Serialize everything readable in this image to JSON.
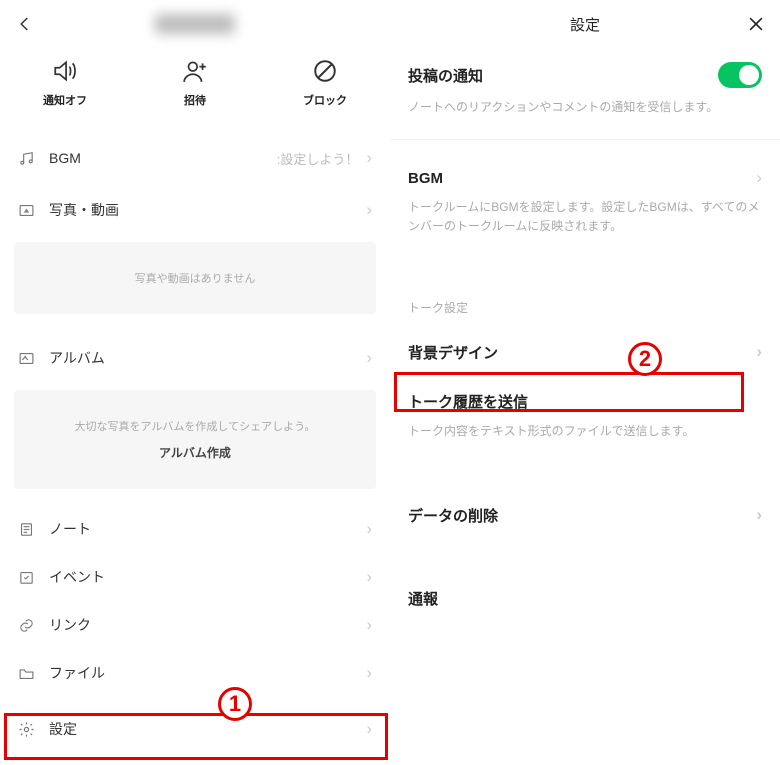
{
  "left": {
    "actions": {
      "mute": "通知オフ",
      "invite": "招待",
      "block": "ブロック"
    },
    "bgm": {
      "label": "BGM",
      "hint": ":設定しよう！"
    },
    "photos": {
      "label": "写真・動画",
      "empty": "写真や動画はありません"
    },
    "album": {
      "label": "アルバム",
      "empty1": "大切な写真をアルバムを作成してシェアしよう。",
      "create": "アルバム作成"
    },
    "rows": {
      "note": "ノート",
      "event": "イベント",
      "link": "リンク",
      "file": "ファイル",
      "settings": "設定"
    }
  },
  "right": {
    "title": "設定",
    "postNotif": {
      "title": "投稿の通知",
      "desc": "ノートへのリアクションやコメントの通知を受信します。"
    },
    "bgm": {
      "title": "BGM",
      "desc": "トークルームにBGMを設定します。設定したBGMは、すべてのメンバーのトークルームに反映されます。"
    },
    "groupLabel": "トーク設定",
    "bgDesign": "背景デザイン",
    "sendHistory": {
      "title": "トーク履歴を送信",
      "desc": "トーク内容をテキスト形式のファイルで送信します。"
    },
    "deleteData": "データの削除",
    "report": "通報"
  },
  "annotations": {
    "num1": "1",
    "num2": "2"
  }
}
